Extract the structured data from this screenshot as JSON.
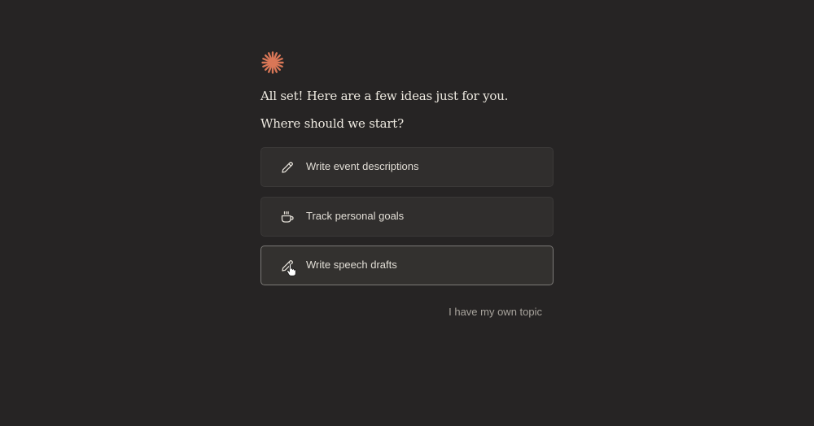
{
  "brand": {
    "logo_icon": "sparkle-burst-icon",
    "accent_color": "#d97757"
  },
  "intro": {
    "greeting": "All set! Here are a few ideas just for you.",
    "question": "Where should we start?"
  },
  "options": [
    {
      "label": "Write event descriptions",
      "icon": "pencil-icon"
    },
    {
      "label": "Track personal goals",
      "icon": "coffee-cup-icon"
    },
    {
      "label": "Write speech drafts",
      "icon": "pencil-icon",
      "hovered": true
    }
  ],
  "own_topic_label": "I have my own topic"
}
